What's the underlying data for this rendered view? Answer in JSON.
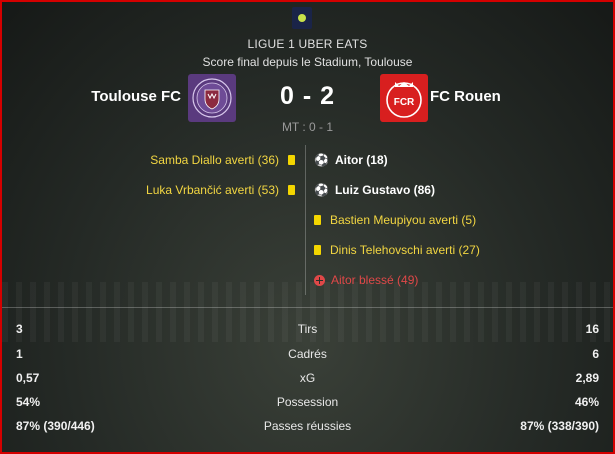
{
  "league": {
    "name": "LIGUE 1 UBER EATS",
    "logo": "ligue1-logo-icon"
  },
  "venue": "Score final depuis le Stadium, Toulouse",
  "home": {
    "name": "Toulouse FC",
    "crest": "toulouse-fc-crest",
    "color": "#5a3a7e"
  },
  "away": {
    "name": "FC Rouen",
    "crest": "fc-rouen-crest",
    "color": "#d81f1f",
    "crest_text": "FCR"
  },
  "score": "0 - 2",
  "halftime": "MT : 0 - 1",
  "events_home": [
    {
      "text": "Samba Diallo averti (36)",
      "type": "yellow-card"
    },
    {
      "text": "Luka Vrbančić averti (53)",
      "type": "yellow-card"
    }
  ],
  "events_away": [
    {
      "text": "Aitor (18)",
      "type": "goal"
    },
    {
      "text": "Luiz Gustavo (86)",
      "type": "goal"
    },
    {
      "text": "Bastien Meupiyou averti (5)",
      "type": "yellow-card"
    },
    {
      "text": "Dinis Telehovschi averti (27)",
      "type": "yellow-card"
    },
    {
      "text": "Aitor blessé (49)",
      "type": "injury"
    }
  ],
  "stats": [
    {
      "label": "Tirs",
      "home": "3",
      "away": "16"
    },
    {
      "label": "Cadrés",
      "home": "1",
      "away": "6"
    },
    {
      "label": "xG",
      "home": "0,57",
      "away": "2,89"
    },
    {
      "label": "Possession",
      "home": "54%",
      "away": "46%"
    },
    {
      "label": "Passes réussies",
      "home": "87% (390/446)",
      "away": "87% (338/390)"
    }
  ],
  "colors": {
    "accent_border": "#d40000",
    "card_yellow": "#f4d600",
    "injury_red": "#e04848",
    "event_yellow_text": "#f2d642"
  }
}
